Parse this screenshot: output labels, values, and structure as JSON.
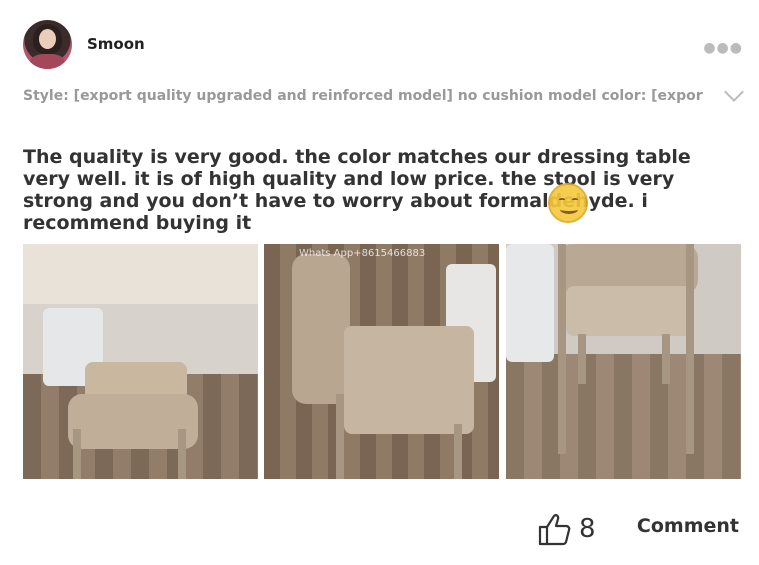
{
  "review": {
    "username": "Smoon",
    "more_icon": "more-dots-icon",
    "style_text": "Style: [export quality upgraded and reinforced model] no cushion model color: [export..",
    "body_text": "The quality is very good. the color matches our dressing table very well. it is of high quality and low price. the stool is very strong and you don’t have to worry about formaldehyde. i recommend buying it",
    "photos": [
      {
        "name": "review-photo-1",
        "desc": "chair under dressing table"
      },
      {
        "name": "review-photo-2",
        "desc": "chair side view",
        "watermark": "Whats App+8615466883"
      },
      {
        "name": "review-photo-3",
        "desc": "chair front view"
      }
    ],
    "like_count": "8",
    "comment_label": "Comment"
  }
}
